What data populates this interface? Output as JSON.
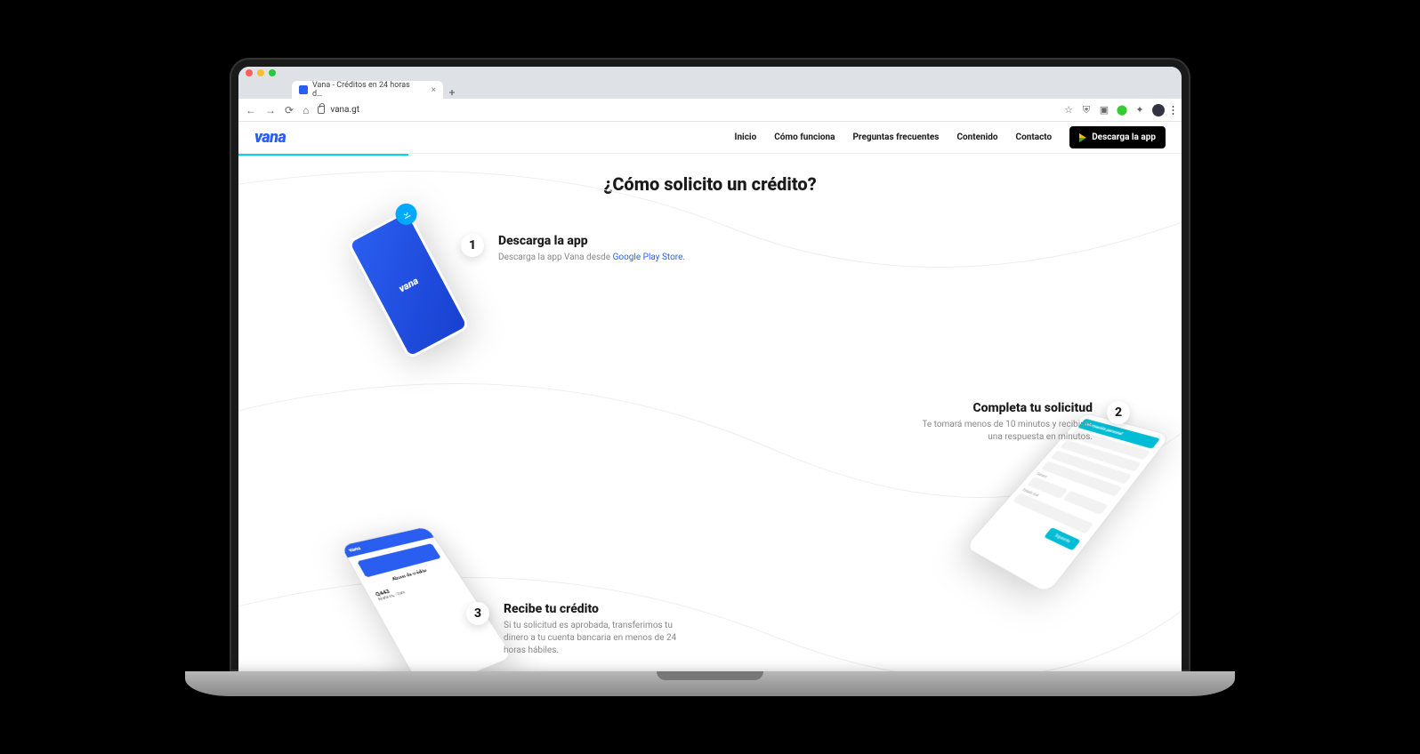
{
  "browser": {
    "tab_title": "Vana - Créditos en 24 horas d…",
    "url": "vana.gt"
  },
  "header": {
    "logo": "vana",
    "nav": {
      "inicio": "Inicio",
      "como_funciona": "Cómo funciona",
      "preguntas": "Preguntas frecuentes",
      "contenido": "Contenido",
      "contacto": "Contacto"
    },
    "cta": "Descarga la app"
  },
  "section": {
    "title": "¿Cómo solicito un crédito?"
  },
  "steps": {
    "s1": {
      "num": "1",
      "title": "Descarga la app",
      "desc": "Descarga la app Vana desde ",
      "link": "Google Play Store",
      "phone_brand": "vana"
    },
    "s2": {
      "num": "2",
      "title": "Completa tu solicitud",
      "desc": "Te tomará menos de 10 minutos y recibirás una respuesta en minutos.",
      "form_title": "Información personal",
      "btn": "Siguiente"
    },
    "s3": {
      "num": "3",
      "title": "Recibe tu crédito",
      "desc": "Si tu solicitud es aprobada, transferimos tu dinero a tu cuenta bancaria en menos de 24 horas hábiles.",
      "phone_brand": "vana",
      "card_title": "Abono de crédito",
      "amount": "Q443",
      "time": "Mañana, 12pm"
    }
  }
}
